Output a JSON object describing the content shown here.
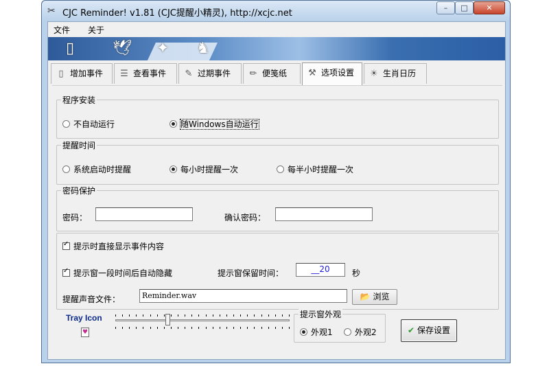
{
  "window": {
    "title": "CJC Reminder! v1.81 (CJC提醒小精灵), http://xcjc.net",
    "controls": {
      "minimize": "–",
      "maximize": "□",
      "close": "✕"
    }
  },
  "menu": {
    "items": [
      "文件",
      "关于"
    ]
  },
  "banner": {
    "icons": [
      "door-icon",
      "dove-icon",
      "bird-icon",
      "horse-icon"
    ]
  },
  "tabs": [
    {
      "label": "增加事件",
      "icon": "new-document-icon"
    },
    {
      "label": "查看事件",
      "icon": "list-icon"
    },
    {
      "label": "过期事件",
      "icon": "expired-icon"
    },
    {
      "label": "便笺纸",
      "icon": "pencil-icon"
    },
    {
      "label": "选项设置",
      "icon": "tools-icon",
      "active": true
    },
    {
      "label": "生肖日历",
      "icon": "sun-icon"
    }
  ],
  "install": {
    "title": "程序安装",
    "options": [
      "不自动运行",
      "随Windows自动运行"
    ],
    "selected": 1
  },
  "remind_time": {
    "title": "提醒时间",
    "options": [
      "系统启动时提醒",
      "每小时提醒一次",
      "每半小时提醒一次"
    ],
    "selected": 1
  },
  "password": {
    "title": "密码保护",
    "password_label": "密码：",
    "password_value": "",
    "confirm_label": "确认密码：",
    "confirm_value": ""
  },
  "options": {
    "show_content_label": "提示时直接显示事件内容",
    "show_content_checked": true,
    "auto_hide_label": "提示窗一段时间后自动隐藏",
    "auto_hide_checked": true,
    "keep_time_label": "提示窗保留时间：",
    "keep_time_value": "__20",
    "seconds_unit": "秒",
    "sound_label": "提醒声音文件：",
    "sound_value": "Reminder.wav",
    "browse_label": "浏览"
  },
  "tray": {
    "label": "Tray Icon",
    "slider_fraction": 0.3
  },
  "appearance": {
    "title": "提示窗外观",
    "options": [
      "外观1",
      "外观2"
    ],
    "selected": 0
  },
  "save_button": {
    "label": "保存设置"
  },
  "colors": {
    "accent": "#b9d1ea",
    "tray_label": "#0a2a8a",
    "number": "#1a1ad6"
  }
}
